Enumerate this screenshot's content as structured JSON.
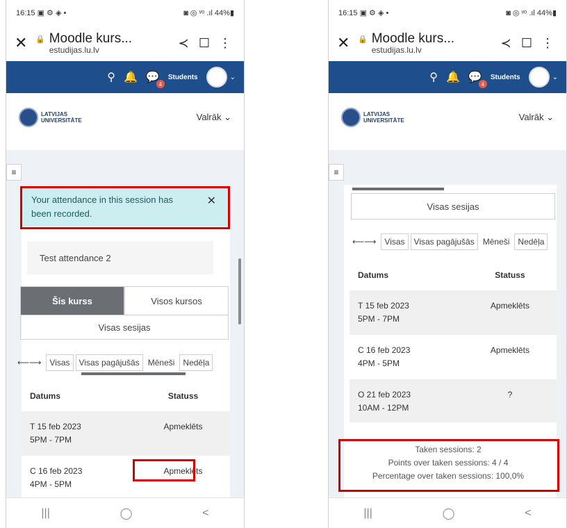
{
  "status": {
    "time": "16:15",
    "left_icons": "▣ ⚙ ◈ •",
    "right": "◙ ◎ ᵛᵒ .ıl 44%▮"
  },
  "browser": {
    "title": "Moodle kurs...",
    "url": "estudijas.lu.lv",
    "close": "✕",
    "share": "≺",
    "bookmark": "☐",
    "menu": "⋮"
  },
  "navbar": {
    "search": "⚲",
    "bell": "🔔",
    "chat": "💬",
    "badge": "4",
    "role": "Students",
    "caret": "⌄"
  },
  "brand": {
    "logo_line1": "LATVIJAS",
    "logo_line2": "UNIVERSITĀTE",
    "lang": "Valrāk ⌄"
  },
  "drawer": "≡",
  "left": {
    "alert": "Your attendance in this session has been recorded.",
    "alert_close": "✕",
    "session": "Test attendance 2",
    "tabs": [
      "Šis kurss",
      "Visos kursos"
    ],
    "all_sessions": "Visas sesijas",
    "filters": [
      "⟵⟶",
      "Visas",
      "Visas pagājušās",
      "Mēneši",
      "Nedēļa"
    ],
    "table": {
      "headers": [
        "Datums",
        "Statuss"
      ],
      "rows": [
        {
          "date": "T 15 feb 2023",
          "time": "5PM - 7PM",
          "status": "Apmeklēts"
        },
        {
          "date": "C 16 feb 2023",
          "time": "4PM - 5PM",
          "status": "Apmeklēts"
        }
      ]
    }
  },
  "right": {
    "all_sessions": "Visas sesijas",
    "filters": [
      "⟵⟶",
      "Visas",
      "Visas pagājušās",
      "Mēneši",
      "Nedēļa"
    ],
    "table": {
      "headers": [
        "Datums",
        "Statuss"
      ],
      "rows": [
        {
          "date": "T 15 feb 2023",
          "time": "5PM - 7PM",
          "status": "Apmeklēts"
        },
        {
          "date": "C 16 feb 2023",
          "time": "4PM - 5PM",
          "status": "Apmeklēts"
        },
        {
          "date": "O 21 feb 2023",
          "time": "10AM - 12PM",
          "status": "?"
        }
      ]
    },
    "summary": {
      "taken": "Taken sessions: 2",
      "points": "Points over taken sessions: 4 / 4",
      "percentage": "Percentage over taken sessions: 100,0%"
    }
  },
  "sysnav": {
    "recent": "|||",
    "home": "◯",
    "back": "<"
  },
  "colors": {
    "navbar": "#1f4e8c",
    "alert_bg": "#cdeef0",
    "highlight": "#d40000"
  }
}
